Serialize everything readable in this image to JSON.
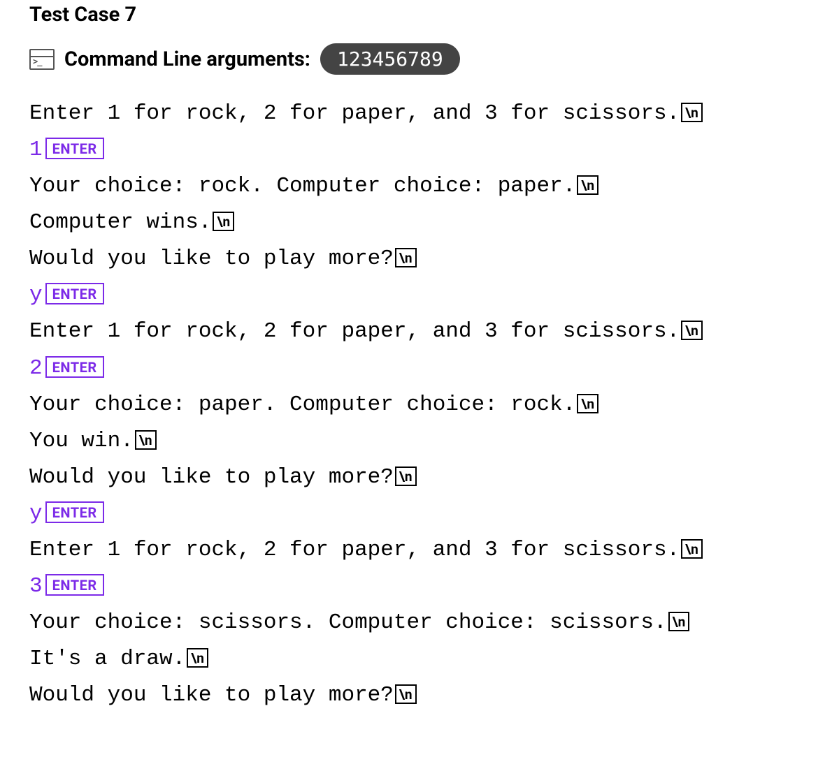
{
  "title": "Test Case 7",
  "args": {
    "label": "Command Line arguments:",
    "value": "123456789"
  },
  "badges": {
    "newline": "\\n",
    "enter": "ENTER"
  },
  "lines": [
    {
      "kind": "out",
      "text": "Enter 1 for rock, 2 for paper, and 3 for scissors."
    },
    {
      "kind": "in",
      "text": "1"
    },
    {
      "kind": "out",
      "text": "Your choice: rock. Computer choice: paper."
    },
    {
      "kind": "out",
      "text": "Computer wins."
    },
    {
      "kind": "out",
      "text": "Would you like to play more?"
    },
    {
      "kind": "in",
      "text": "y"
    },
    {
      "kind": "out",
      "text": "Enter 1 for rock, 2 for paper, and 3 for scissors."
    },
    {
      "kind": "in",
      "text": "2"
    },
    {
      "kind": "out",
      "text": "Your choice: paper. Computer choice: rock."
    },
    {
      "kind": "out",
      "text": "You win."
    },
    {
      "kind": "out",
      "text": "Would you like to play more?"
    },
    {
      "kind": "in",
      "text": "y"
    },
    {
      "kind": "out",
      "text": "Enter 1 for rock, 2 for paper, and 3 for scissors."
    },
    {
      "kind": "in",
      "text": "3"
    },
    {
      "kind": "out",
      "text": "Your choice: scissors. Computer choice: scissors."
    },
    {
      "kind": "out",
      "text": "It's a draw."
    },
    {
      "kind": "out",
      "text": "Would you like to play more?"
    }
  ]
}
